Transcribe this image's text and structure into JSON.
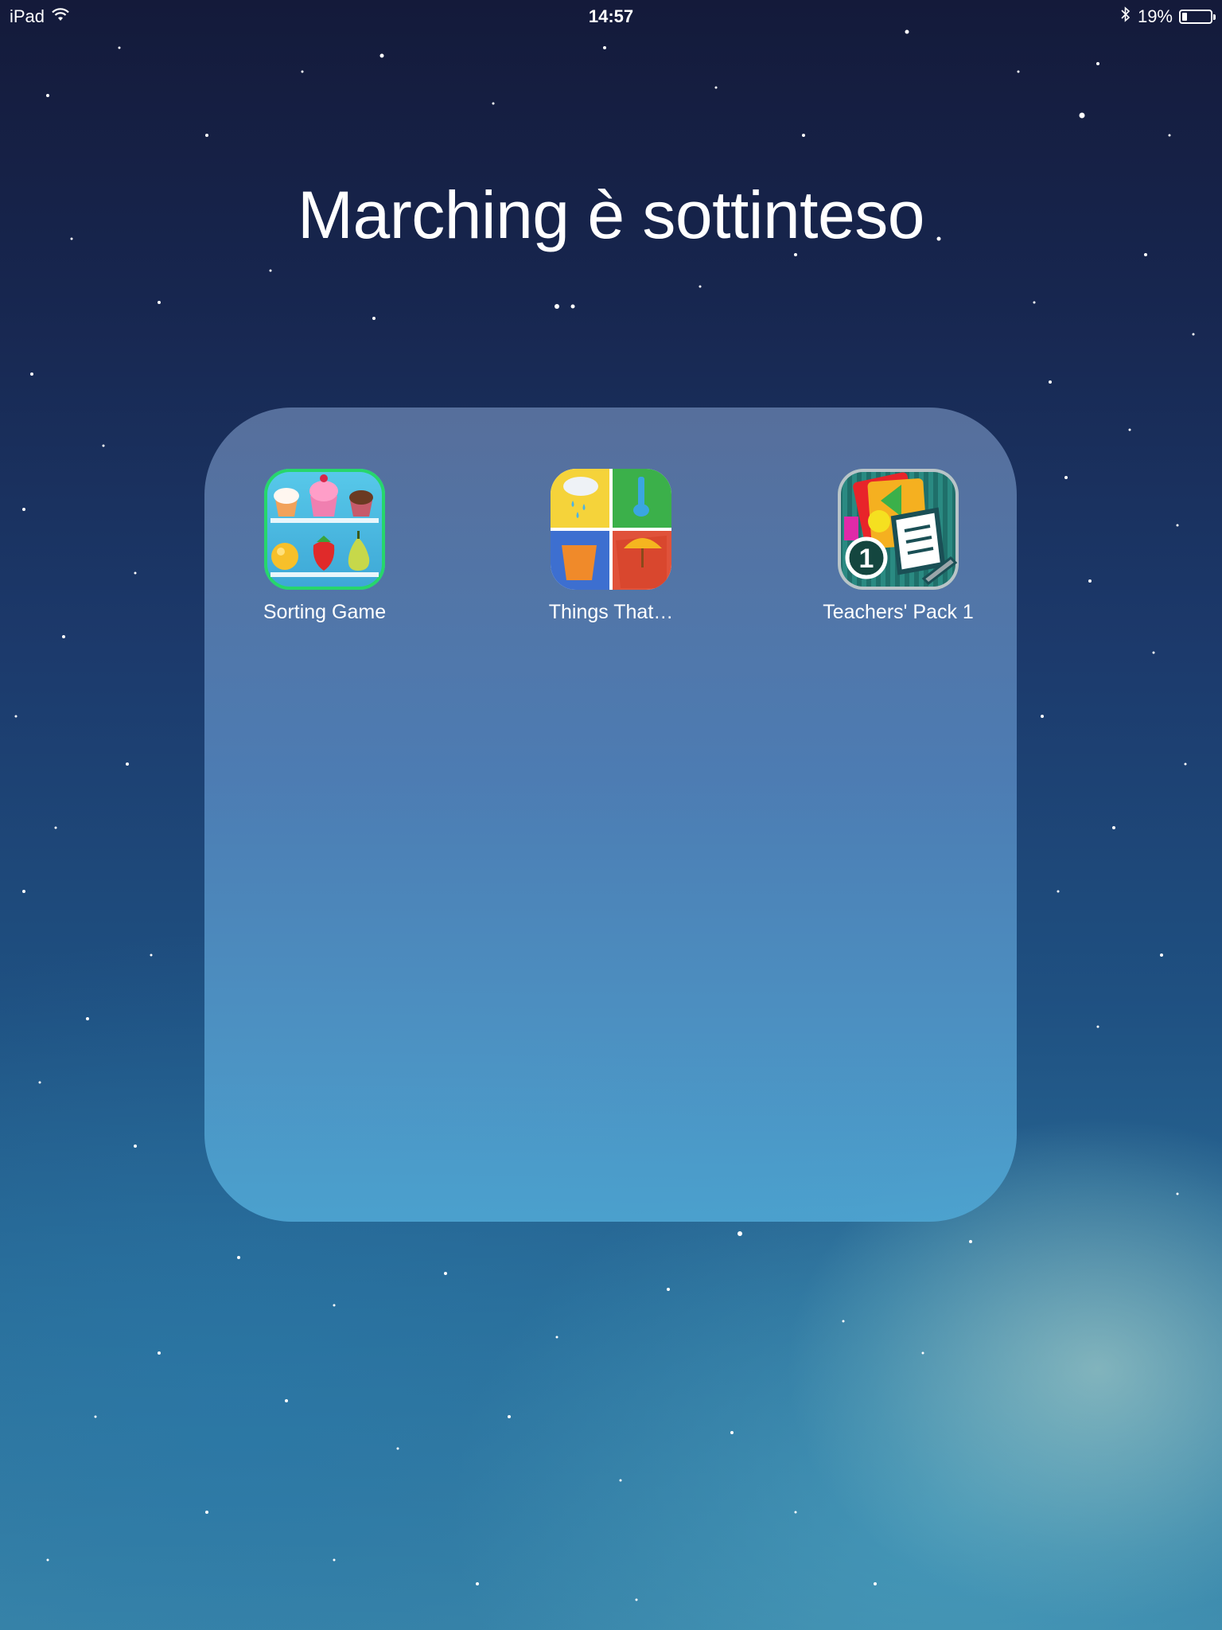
{
  "status_bar": {
    "device": "iPad",
    "time": "14:57",
    "battery_text": "19%",
    "battery_level": 0.19,
    "wifi_icon": "wifi-icon",
    "bluetooth_icon": "bluetooth-icon"
  },
  "folder": {
    "title": "Marching è sottinteso",
    "apps": [
      {
        "label": "Sorting Game",
        "icon": "sorting-game-icon"
      },
      {
        "label": "Things That…",
        "icon": "things-that-icon"
      },
      {
        "label": "Teachers' Pack 1",
        "icon": "teachers-pack-icon"
      }
    ]
  },
  "colors": {
    "folder_panel": "#5a82b6",
    "sorting_border": "#27d66b",
    "teachers_teal": "#1f6f6a"
  }
}
